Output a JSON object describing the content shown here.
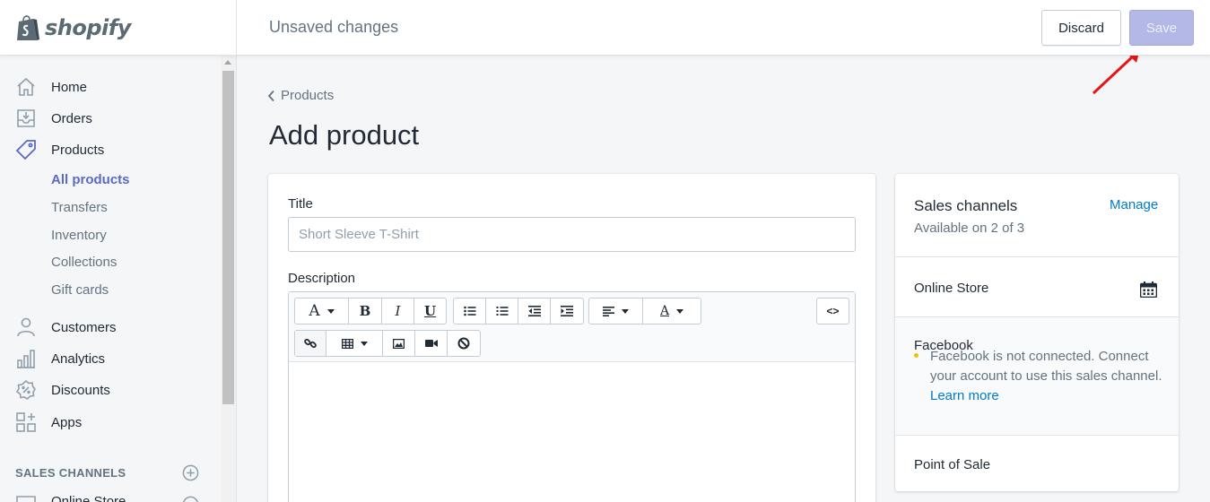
{
  "app": {
    "logo_text": "shopify",
    "status": "Unsaved changes",
    "discard_label": "Discard",
    "save_label": "Save",
    "accent": "#5c6ac4",
    "save_disabled_bg": "#b3b8e6",
    "link_color": "#007ace"
  },
  "sidebar": {
    "items": [
      {
        "label": "Home",
        "icon": "home-icon"
      },
      {
        "label": "Orders",
        "icon": "orders-inbox-icon"
      },
      {
        "label": "Products",
        "icon": "tag-icon"
      },
      {
        "label": "Customers",
        "icon": "person-icon"
      },
      {
        "label": "Analytics",
        "icon": "bar-chart-icon"
      },
      {
        "label": "Discounts",
        "icon": "discount-badge-icon"
      },
      {
        "label": "Apps",
        "icon": "apps-grid-icon"
      }
    ],
    "product_subitems": [
      "All products",
      "Transfers",
      "Inventory",
      "Collections",
      "Gift cards"
    ],
    "active_subitem": "All products",
    "section_heading": "SALES CHANNELS",
    "partial_item": "Online Store"
  },
  "main": {
    "breadcrumb": "Products",
    "page_title": "Add product",
    "title_label": "Title",
    "title_placeholder": "Short Sleeve T-Shirt",
    "title_value": "",
    "description_label": "Description",
    "toolbar": {
      "row1": [
        "font-icon",
        "bold-icon",
        "italic-icon",
        "underline-icon",
        "bullet-list-icon",
        "numbered-list-icon",
        "outdent-icon",
        "indent-icon",
        "align-left-icon",
        "text-color-icon",
        "html-code-icon"
      ],
      "row2": [
        "link-icon",
        "table-icon",
        "image-icon",
        "video-icon",
        "clear-format-icon"
      ],
      "font_glyph": "A",
      "bold_glyph": "B",
      "italic_glyph": "I",
      "underline_glyph": "U",
      "color_glyph": "A",
      "code_glyph": "<>"
    }
  },
  "sales_channels": {
    "title": "Sales channels",
    "manage_label": "Manage",
    "subtitle": "Available on 2 of 3",
    "online_store": "Online Store",
    "facebook": "Facebook",
    "facebook_note": "Facebook is not connected. Connect your account to use this sales channel.",
    "learn_more": "Learn more",
    "pos": "Point of Sale"
  }
}
